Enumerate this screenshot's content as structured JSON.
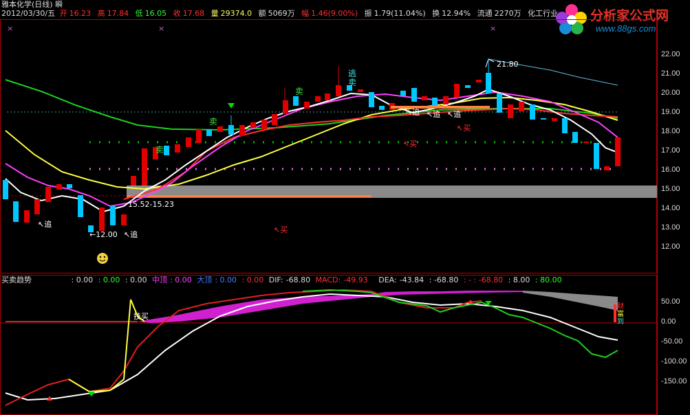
{
  "title": {
    "stock_name": "雅本化学",
    "period": "(日线)",
    "suffix": "瞬"
  },
  "info": {
    "date": "2012/03/30/五",
    "open_label": "开",
    "open": "16.23",
    "high_label": "高",
    "high": "17.84",
    "low_label": "低",
    "low": "16.05",
    "close_label": "收",
    "close": "17.68",
    "volume_label": "量",
    "volume": "29374.0",
    "amount_label": "额",
    "amount": "5069万",
    "change_label": "幅",
    "change": "1.46(9.00%)",
    "amplitude_label": "振",
    "amplitude": "1.79(11.04%)",
    "turnover_label": "换",
    "turnover": "12.94%",
    "float_label": "流通",
    "float_shares": "2270万",
    "industry": "化工行业"
  },
  "logo": {
    "brand": "分析家公式网",
    "url": "www.88gs.com"
  },
  "colors": {
    "bg": "#000000",
    "frame": "#b00000",
    "up": "#e00000",
    "down": "#00c8ff",
    "white": "#ffffff",
    "yellow": "#ffff40",
    "magenta": "#ff00ff",
    "green": "#00e000",
    "red": "#ff2020",
    "gray": "#8a8a8a"
  },
  "main_axis": {
    "ticks": [
      "22.00",
      "21.00",
      "20.00",
      "19.00",
      "18.00",
      "17.00",
      "16.00",
      "15.00",
      "14.00",
      "13.00",
      "12.00"
    ]
  },
  "main_annotations": {
    "peak_price": "21.80",
    "range_label": "15.52-15.23",
    "low_label": "←12.00",
    "chase": "追",
    "sell": "卖",
    "escape": "逃",
    "buy": "买",
    "arrow_chase": "↖追",
    "arrow_buy": "↖买"
  },
  "sub_header": {
    "name": "买卖趋势",
    "v1": ": 0.00",
    "v2": ": 0.00",
    "v3": ": 0.00",
    "mid_top_label": "中顶",
    "mid_top": ": 0.00",
    "big_top_label": "大顶",
    "big_top": ": 0.00",
    "v4": ": 0.00",
    "dif_label": "DIF:",
    "dif": "-68.80",
    "macd_label": "MACD:",
    "macd": "-49.93",
    "dea_label": "DEA:",
    "dea": "-43.84",
    "v5": ": -68.80",
    "v6": ": -  : -68.80",
    "v7": ": 8.00",
    "v8": ": 80.00"
  },
  "sub_axis": {
    "ticks": [
      "50.00",
      "0.00",
      "-50.00",
      "-100.00",
      "-150.00"
    ]
  },
  "sub_annotations": {
    "tech_buy": "技买",
    "cai": "财",
    "fu": "富",
    "dao": "到"
  }
}
